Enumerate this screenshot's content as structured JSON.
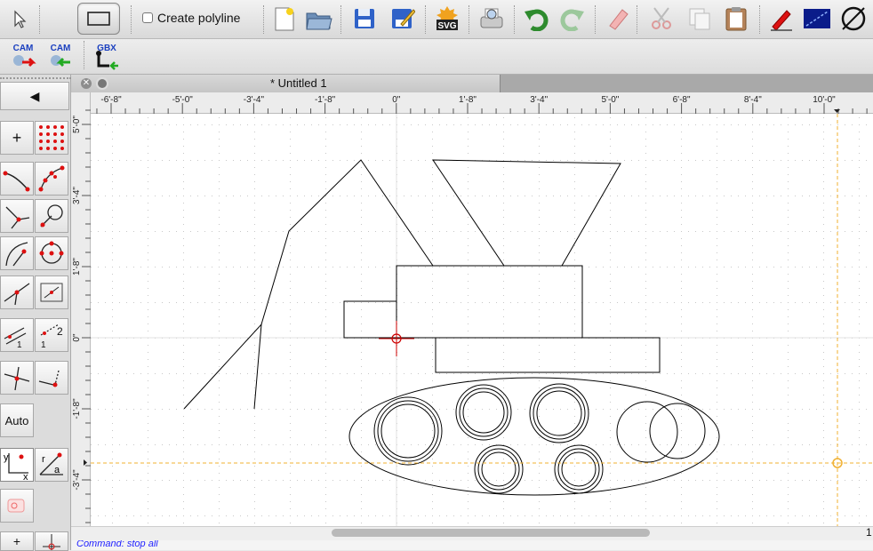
{
  "toolbar": {
    "create_polyline_label": "Create polyline",
    "cam_export_label": "CAM",
    "cam_import_label": "CAM",
    "gbx_label": "GBX",
    "svg_label": "SVG"
  },
  "document": {
    "tab_title": "* Untitled 1"
  },
  "left_dock": {
    "collapse_arrow": "◀",
    "plus_label": "+",
    "auto_label": "Auto",
    "y_label": "y",
    "x_label": "x",
    "r_label": "r",
    "a_label": "a",
    "one_label": "1",
    "two_label": "2"
  },
  "rulers": {
    "horizontal": [
      "-6'-8\"",
      "-5'-0\"",
      "-3'-4\"",
      "-1'-8\"",
      "0\"",
      "1'-8\"",
      "3'-4\"",
      "5'-0\"",
      "6'-8\"",
      "8'-4\"",
      "10'-0\""
    ],
    "vertical": [
      "5'-0\"",
      "3'-4\"",
      "1'-8\"",
      "0\"",
      "-1'-8\"",
      "-3'-4\""
    ]
  },
  "status": {
    "command_line_text": "Command: stop all",
    "right_value": "1"
  },
  "colors": {
    "crosshair": "#cc0000",
    "guide": "#f0b030",
    "grid_dot": "#c8c8c8",
    "geometry": "#000000"
  }
}
